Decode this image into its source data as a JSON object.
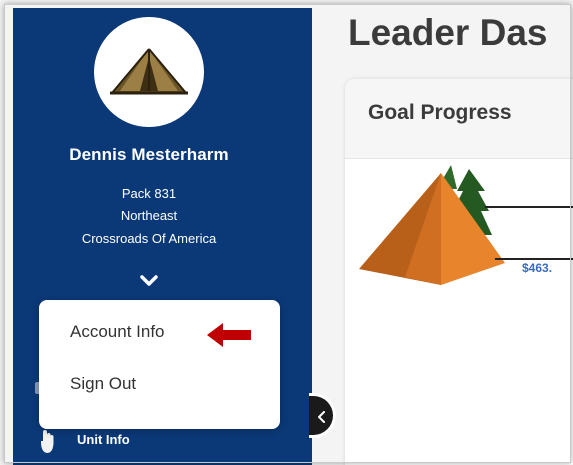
{
  "sidebar": {
    "user": {
      "name": "Dennis Mesterharm",
      "pack": "Pack 831",
      "district": "Northeast",
      "council": "Crossroads Of America",
      "avatar_icon": "tent-icon"
    },
    "expand_icon": "chevron-down-icon",
    "items": [
      {
        "label": "Unit Info",
        "icon": "hand-icon"
      }
    ]
  },
  "account_menu": {
    "items": [
      {
        "label": "Account Info",
        "highlighted": true
      },
      {
        "label": "Sign Out"
      }
    ],
    "pointer_icon": "arrow-left-icon",
    "pointer_color": "#c00000"
  },
  "collapse_toggle": {
    "icon": "chevron-left-icon"
  },
  "main": {
    "page_title": "Leader Das",
    "goal_card": {
      "title": "Goal Progress",
      "amount_label": "$463."
    }
  },
  "colors": {
    "sidebar_bg": "#0b3978",
    "tent_fill": "#8a6d3b",
    "pyramid_orange": "#e07a26",
    "tree_green": "#2e6b2a",
    "amount_text": "#3a6bc4"
  }
}
